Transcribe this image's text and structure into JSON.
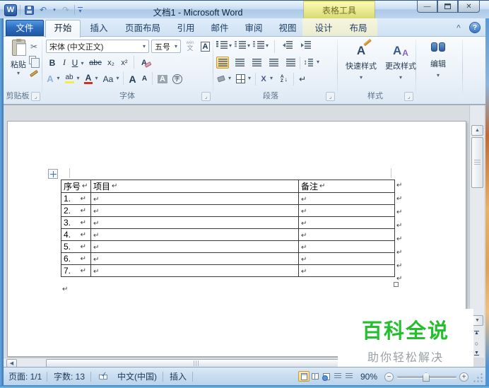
{
  "window": {
    "title": "文档1 - Microsoft Word",
    "contextual_tool_title": "表格工具"
  },
  "qat": {
    "logo": "W"
  },
  "glyphs": {
    "dropdown": "▾",
    "undo": "↶",
    "redo": "↷",
    "minimize": "—",
    "close": "✕",
    "collapse_ribbon": "^",
    "help": "?",
    "cut": "✂",
    "pilcrow": "↵",
    "up": "▲",
    "down": "▼",
    "left": "◀",
    "circle": "○",
    "check": "✓",
    "zoom_out": "−",
    "zoom_in": "+",
    "updown": "↕",
    "arrow_down": "↓",
    "sort_a": "A",
    "sort_z": "Z"
  },
  "tabs": [
    {
      "label": "文件"
    },
    {
      "label": "开始"
    },
    {
      "label": "插入"
    },
    {
      "label": "页面布局"
    },
    {
      "label": "引用"
    },
    {
      "label": "邮件"
    },
    {
      "label": "审阅"
    },
    {
      "label": "视图"
    },
    {
      "label": "设计"
    },
    {
      "label": "布局"
    }
  ],
  "ribbon": {
    "clipboard": {
      "paste": "粘贴",
      "label": "剪贴板"
    },
    "font": {
      "family": "宋体 (中文正文)",
      "size": "五号",
      "bold": "B",
      "italic": "I",
      "underline": "U",
      "strikethrough": "abc",
      "subscript": "x₂",
      "superscript": "x²",
      "clear_format": "A",
      "text_effects": "A",
      "highlight": "ab",
      "font_color": "A",
      "change_case": "Aa",
      "grow_font": "A",
      "shrink_font": "A",
      "char_shading": "A",
      "char_border": "A",
      "enclose": "字",
      "phonetic_top": "wén",
      "phonetic_bottom": "文",
      "label": "字体"
    },
    "paragraph": {
      "label": "段落",
      "asian_layout": "X"
    },
    "styles": {
      "quick": "快速样式",
      "change": "更改样式",
      "quick_icon": "A",
      "change_icon_big": "A",
      "change_icon_small": "A",
      "label": "样式"
    },
    "editing": {
      "label": "编辑"
    }
  },
  "table": {
    "headers": [
      "序号",
      "项目",
      "备注"
    ],
    "rows": [
      {
        "num": "1."
      },
      {
        "num": "2."
      },
      {
        "num": "3."
      },
      {
        "num": "4."
      },
      {
        "num": "5."
      },
      {
        "num": "6."
      },
      {
        "num": "7."
      }
    ]
  },
  "status": {
    "page": "页面: 1/1",
    "words": "字数: 13",
    "language": "中文(中国)",
    "insert_mode": "插入",
    "zoom": "90%"
  },
  "watermark": {
    "title": "百科全说",
    "subtitle": "助你轻松解决"
  },
  "colors": {
    "watermark_green": "#23bf2d",
    "contextual_yellow": "#e9e98e",
    "file_tab_blue": "#2d6cbd"
  }
}
